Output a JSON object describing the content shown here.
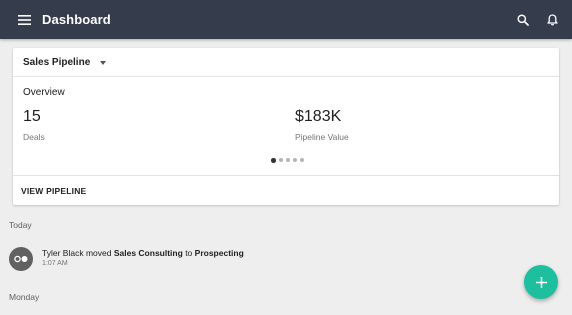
{
  "appbar": {
    "title": "Dashboard",
    "icons": {
      "menu": "menu-icon",
      "search": "search-icon",
      "notifications": "bell-icon"
    },
    "color": "#353c4b"
  },
  "card": {
    "dropdown_label": "Sales Pipeline",
    "overview_label": "Overview",
    "metrics": [
      {
        "value": "15",
        "label": "Deals"
      },
      {
        "value": "$183K",
        "label": "Pipeline Value"
      }
    ],
    "pager": {
      "pages": 5,
      "active": 1
    },
    "footer_link": "VIEW PIPELINE"
  },
  "feed": {
    "sections": [
      {
        "label": "Today",
        "items": [
          {
            "actor": "Tyler Black",
            "verb": "moved",
            "subject": "Sales Consulting",
            "preposition": "to",
            "target": "Prospecting",
            "time": "1:07 AM",
            "icon": "pipeline-move-icon"
          }
        ]
      },
      {
        "label": "Monday",
        "items": []
      }
    ]
  },
  "fab": {
    "icon": "plus-icon",
    "color": "#1dbf9f"
  }
}
